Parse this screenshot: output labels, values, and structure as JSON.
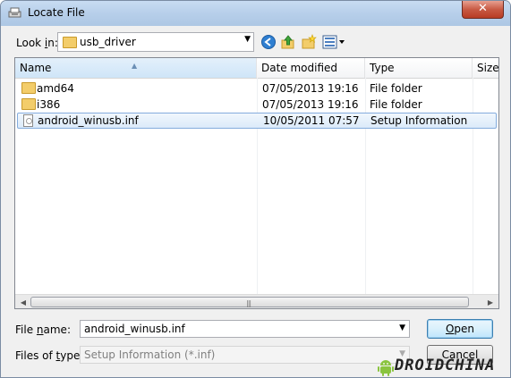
{
  "window": {
    "title": "Locate File",
    "close_symbol": "✕"
  },
  "look_in": {
    "label_prefix": "Look ",
    "label_underlined": "i",
    "label_suffix": "n:",
    "value": "usb_driver"
  },
  "toolbar": {
    "icons": [
      "back-icon",
      "up-folder-icon",
      "new-folder-icon",
      "view-menu-icon"
    ]
  },
  "columns": [
    {
      "label": "Name"
    },
    {
      "label": "Date modified"
    },
    {
      "label": "Type"
    },
    {
      "label": "Size"
    }
  ],
  "files": [
    {
      "name": "amd64",
      "date": "07/05/2013 19:16",
      "type": "File folder",
      "icon": "folder-icon"
    },
    {
      "name": "i386",
      "date": "07/05/2013 19:16",
      "type": "File folder",
      "icon": "folder-icon"
    },
    {
      "name": "android_winusb.inf",
      "date": "10/05/2011 07:57",
      "type": "Setup Information",
      "icon": "setup-file-icon",
      "selected": true
    }
  ],
  "file_name": {
    "label_prefix": "File ",
    "label_underlined": "n",
    "label_suffix": "ame:",
    "value": "android_winusb.inf"
  },
  "file_type": {
    "label_prefix": "Files of ",
    "label_underlined": "t",
    "label_suffix": "ype:",
    "value": "Setup Information (*.inf)"
  },
  "buttons": {
    "open_underlined": "O",
    "open_rest": "pen",
    "cancel": "Cancel"
  },
  "watermark": {
    "text": "DROIDCHINA"
  },
  "colors": {
    "title_gradient": "#b7cfea",
    "selection": "#dbeaf9",
    "default_button_border": "#3c7fb1"
  }
}
